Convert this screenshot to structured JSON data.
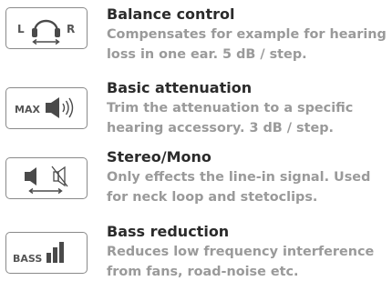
{
  "features": [
    {
      "icon": "headphones-balance-icon",
      "icon_left": "L",
      "icon_right": "R",
      "title": "Balance control",
      "desc_line1": "Compensates for example for hearing",
      "desc_line2": "loss in one ear. 5 dB / step."
    },
    {
      "icon": "max-volume-speaker-icon",
      "icon_label": "MAX",
      "title": "Basic attenuation",
      "desc_line1": "Trim the attenuation to a specific",
      "desc_line2": "hearing accessory.  3 dB / step."
    },
    {
      "icon": "stereo-mono-speaker-icon",
      "title": "Stereo/Mono",
      "desc_line1": "Only effects the line-in signal. Used",
      "desc_line2": "for neck loop and stetoclips."
    },
    {
      "icon": "bass-bars-icon",
      "icon_label": "BASS",
      "title": "Bass reduction",
      "desc_line1": "Reduces low frequency interference",
      "desc_line2": "from fans, road-noise etc."
    }
  ],
  "colors": {
    "title": "#2b2b2b",
    "description": "#9a9a9a",
    "icon_stroke": "#8a8a8a",
    "icon_fill": "#4a4a4a"
  }
}
